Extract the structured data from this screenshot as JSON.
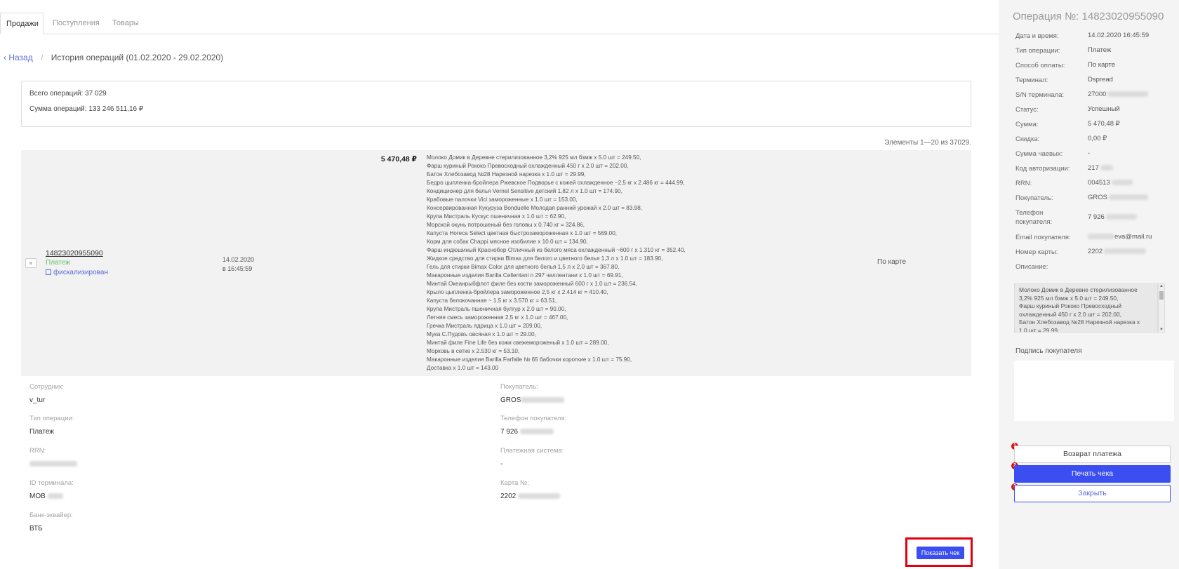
{
  "tabs": [
    {
      "label": "Продажи",
      "active": true
    },
    {
      "label": "Поступления",
      "active": false
    },
    {
      "label": "Товары",
      "active": false
    }
  ],
  "breadcrumb": {
    "back_label": "Назад",
    "separator": "/",
    "title": "История операций (01.02.2020 - 29.02.2020)"
  },
  "summary": {
    "total_ops": "Всего операций: 37 029",
    "total_sum": "Сумма операций: 133 246 511,16 ₽"
  },
  "pagination": {
    "label": "Элементы 1—20 из 37029."
  },
  "operation_row": {
    "id": "14823020955090",
    "type": "Платеж",
    "fiscal_label": "фискализирован",
    "date": "14.02.2020",
    "time": "в 16:45:59",
    "amount": "5 470,48 ₽",
    "payment_method": "По карте",
    "items": [
      "Молоко Домик в Деревне стерилизованное 3,2% 925 мл бзмж x 5.0 шт = 249.50,",
      "Фарш куриный Рококо Превосходный охлажденный 450 г x 2.0 шт = 202.00,",
      "Батон Хлебозавод №28 Нарезной нарезка x 1.0 шт = 29.99,",
      "Бедро цыпленка-бройлера Ржевское Подворье с кожей охлажденное ~2,5 кг x 2.486 кг = 444.99,",
      "Кондиционер для белья Vernel Sensitive детский 1,82 л x 1.0 шт = 174.90,",
      "Крабовые палочки Vici замороженные x 1.0 шт = 153.00,",
      "Консервированная Кукуруза Bonduelle Молодая ранний урожай x 2.0 шт = 83.98,",
      "Крупа Мистраль Кускус пшеничная x 1.0 шт = 62.90,",
      "Морской окунь потрошеный без головы x 0.740 кг = 324.86,",
      "Капуста Horeca Select цветная быстрозамороженная x 1.0 шт = 569.00,",
      "Корм для собак Chappi мясное изобилие x 10.0 шт = 134.90,",
      "Фарш индюшиный Краснобор Отличный из белого мяса охлажденный ~600 г x 1.310 кг = 352.40,",
      "Жидкое средство для стирки Bimax для белого и цветного белья 1,3 л x 1.0 шт = 183.90,",
      "Гель для стирки Bimax Color для цветного белья 1,5 л x 2.0 шт = 367.80,",
      "Макаронные изделия Barilla Cellentani n 297 челлентани x 1.0 шт = 69.91,",
      "Минтай Океанрыбфлот филе без кости замороженный 600 г x 1.0 шт = 236.54,",
      "Крыло цыпленка-бройлера замороженное 2,5 кг x 2.414 кг = 410.40,",
      "Капуста белокочанная ~ 1,5 кг x 3.570 кг = 63.51,",
      "Крупа Мистраль пшеничная булгур x 2.0 шт = 90.00,",
      "Летняя смесь замороженная 2,5 кг x 1.0 шт = 467.00,",
      "Гречка Мистраль ядрица x 1.0 шт = 209.00,",
      "Мука С.Пудовъ овсяная x 1.0 шт = 29.00,",
      "Минтай филе Fine Life без кожи свежемороженый x 1.0 шт = 289.00,",
      "Морковь в сетке x 2.530 кг = 53.10,",
      "Макаронные изделия Barilla Farfalle № 65 бабочки короткие x 1.0 шт = 75.90,",
      "Доставка x 1.0 шт = 143.00"
    ]
  },
  "details": {
    "employee": {
      "label": "Сотрудник:",
      "value": "v_tur"
    },
    "op_type": {
      "label": "Тип операции:",
      "value": "Платеж"
    },
    "rrn": {
      "label": "RRN:",
      "value": ""
    },
    "terminal_id": {
      "label": "ID терминала:",
      "value": "MOB"
    },
    "acquirer": {
      "label": "Банк-эквайер:",
      "value": "ВТБ"
    },
    "buyer": {
      "label": "Покупатель:",
      "value": "GROS"
    },
    "buyer_phone": {
      "label": "Телефон покупателя:",
      "value": "7 926"
    },
    "payment_system": {
      "label": "Платежная система:",
      "value": "-"
    },
    "card": {
      "label": "Карта №:",
      "value": "2202"
    }
  },
  "show_receipt_button": "Показать чек",
  "side_panel": {
    "title": "Операция №: 14823020955090",
    "fields": [
      {
        "key": "Дата и время:",
        "value": "14.02.2020 16:45:59"
      },
      {
        "key": "Тип операции:",
        "value": "Платеж"
      },
      {
        "key": "Способ оплаты:",
        "value": "По карте"
      },
      {
        "key": "Терминал:",
        "value": "Dspread"
      },
      {
        "key": "S/N терминала:",
        "value": "27000"
      },
      {
        "key": "Статус:",
        "value": "Успешный"
      },
      {
        "key": "Сумма:",
        "value": "5 470,48 ₽"
      },
      {
        "key": "Скидка:",
        "value": "0,00 ₽"
      },
      {
        "key": "Сумма чаевых:",
        "value": "-"
      },
      {
        "key": "Код авторизации:",
        "value": "217"
      },
      {
        "key": "RRN:",
        "value": "004513"
      },
      {
        "key": "Покупатель:",
        "value": "GROS"
      },
      {
        "key": "Телефон покупателя:",
        "value": "7 926"
      },
      {
        "key": "Email покупателя:",
        "value": "eva@mail.ru"
      },
      {
        "key": "Номер карты:",
        "value": "2202"
      },
      {
        "key": "Описание:",
        "value": ""
      }
    ],
    "description_lines": [
      "Молоко Домик в Деревне стерилизованное 3,2% 925 мл бзмж x 5.0 шт = 249.50,",
      "Фарш куриный Рококо Превосходный охлажденный 450 г x 2.0 шт = 202.00,",
      "Батон Хлебозавод №28 Нарезной нарезка x 1.0 шт = 29.99"
    ],
    "signature_label": "Подпись покупателя",
    "actions": [
      {
        "badge": "1",
        "label": "Возврат платежа"
      },
      {
        "badge": "2",
        "label": "Печать чека"
      },
      {
        "badge": "3",
        "label": "Закрыть"
      }
    ]
  },
  "colors": {
    "accent": "#3b4ef0",
    "link": "#5b6bd6",
    "success": "#5cbf6e",
    "highlight_frame": "#e0000f",
    "badge": "#d60e0e"
  }
}
